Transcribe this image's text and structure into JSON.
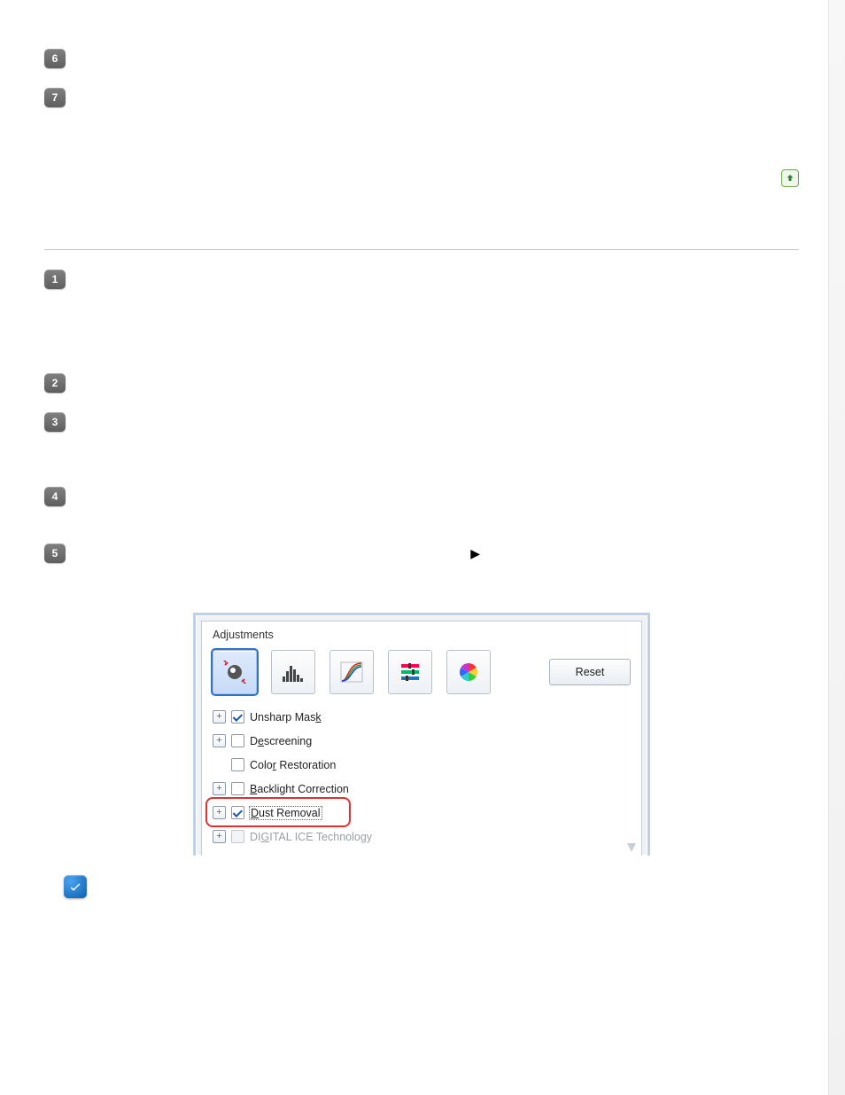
{
  "top_steps": [
    {
      "n": "6",
      "text": ""
    },
    {
      "n": "7",
      "text": ""
    }
  ],
  "go_top": {
    "name": "go-top"
  },
  "section_steps": [
    {
      "n": "1",
      "text": ""
    },
    {
      "n": "2",
      "text": ""
    },
    {
      "n": "3",
      "text": ""
    },
    {
      "n": "4",
      "text": ""
    },
    {
      "n": "5",
      "text_before": "",
      "text_after": ""
    }
  ],
  "triangle_glyph": "▶",
  "panel": {
    "title": "Adjustments",
    "reset_label": "Reset",
    "options": [
      {
        "expander": true,
        "checked": true,
        "label_pre": "Unsharp Mas",
        "accel": "k",
        "label_post": "",
        "disabled": false
      },
      {
        "expander": true,
        "checked": false,
        "label_pre": "D",
        "accel": "e",
        "label_post": "screening",
        "disabled": false
      },
      {
        "expander": false,
        "checked": false,
        "label_pre": "Colo",
        "accel": "r",
        "label_post": " Restoration",
        "disabled": false
      },
      {
        "expander": true,
        "checked": false,
        "label_pre": "",
        "accel": "B",
        "label_post": "acklight Correction",
        "disabled": false
      },
      {
        "expander": true,
        "checked": true,
        "label_pre": "",
        "accel": "D",
        "label_post": "ust Removal",
        "disabled": false,
        "highlight": true
      },
      {
        "expander": true,
        "checked": false,
        "label_pre": "DI",
        "accel": "G",
        "label_post": "ITAL ICE Technology",
        "disabled": true
      }
    ]
  },
  "note_text": ""
}
